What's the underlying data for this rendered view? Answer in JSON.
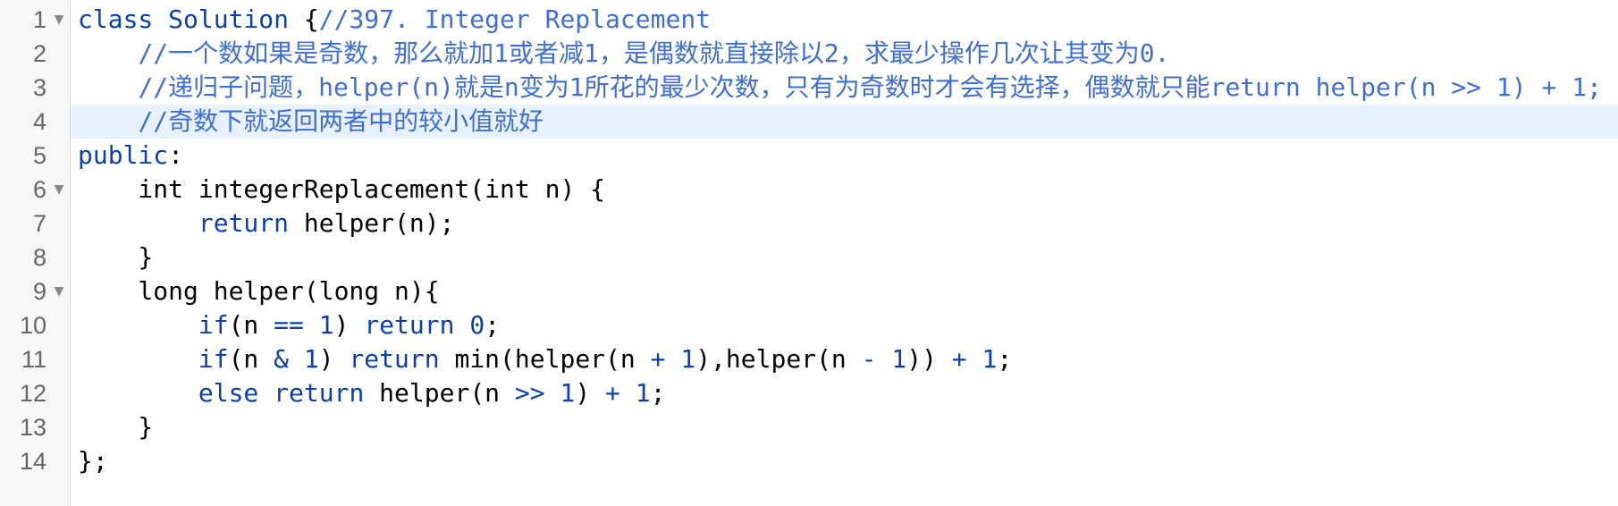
{
  "editor": {
    "active_line": 4,
    "colors": {
      "keyword": "#0b3fb0",
      "comment": "#3f6fd6",
      "plain": "#000000",
      "gutter_bg": "#f7f7f7",
      "active_line_bg": "#e8f2ff"
    },
    "lines": [
      {
        "number": "1",
        "fold": true,
        "tokens": [
          {
            "type": "keyword",
            "text": "class Solution"
          },
          {
            "type": "plain",
            "text": " {"
          },
          {
            "type": "comment",
            "text": "//397. Integer Replacement"
          }
        ]
      },
      {
        "number": "2",
        "fold": false,
        "tokens": [
          {
            "type": "plain",
            "text": "    "
          },
          {
            "type": "comment",
            "text": "//一个数如果是奇数，那么就加1或者减1，是偶数就直接除以2，求最少操作几次让其变为0."
          }
        ]
      },
      {
        "number": "3",
        "fold": false,
        "tokens": [
          {
            "type": "plain",
            "text": "    "
          },
          {
            "type": "comment",
            "text": "//递归子问题，helper(n)就是n变为1所花的最少次数，只有为奇数时才会有选择，偶数就只能return helper(n >> 1) + 1;"
          }
        ]
      },
      {
        "number": "4",
        "fold": false,
        "tokens": [
          {
            "type": "plain",
            "text": "    "
          },
          {
            "type": "comment",
            "text": "//奇数下就返回两者中的较小值就好"
          }
        ]
      },
      {
        "number": "5",
        "fold": false,
        "tokens": [
          {
            "type": "keyword",
            "text": "public"
          },
          {
            "type": "plain",
            "text": ":"
          }
        ]
      },
      {
        "number": "6",
        "fold": true,
        "tokens": [
          {
            "type": "plain",
            "text": "    int integerReplacement(int n) {"
          }
        ]
      },
      {
        "number": "7",
        "fold": false,
        "tokens": [
          {
            "type": "plain",
            "text": "        "
          },
          {
            "type": "keyword",
            "text": "return"
          },
          {
            "type": "plain",
            "text": " helper(n);"
          }
        ]
      },
      {
        "number": "8",
        "fold": false,
        "tokens": [
          {
            "type": "plain",
            "text": "    }"
          }
        ]
      },
      {
        "number": "9",
        "fold": true,
        "tokens": [
          {
            "type": "plain",
            "text": "    long helper(long n){"
          }
        ]
      },
      {
        "number": "10",
        "fold": false,
        "tokens": [
          {
            "type": "plain",
            "text": "        "
          },
          {
            "type": "keyword",
            "text": "if"
          },
          {
            "type": "plain",
            "text": "(n "
          },
          {
            "type": "operator",
            "text": "=="
          },
          {
            "type": "plain",
            "text": " "
          },
          {
            "type": "number",
            "text": "1"
          },
          {
            "type": "plain",
            "text": ") "
          },
          {
            "type": "keyword",
            "text": "return"
          },
          {
            "type": "plain",
            "text": " "
          },
          {
            "type": "number",
            "text": "0"
          },
          {
            "type": "plain",
            "text": ";"
          }
        ]
      },
      {
        "number": "11",
        "fold": false,
        "tokens": [
          {
            "type": "plain",
            "text": "        "
          },
          {
            "type": "keyword",
            "text": "if"
          },
          {
            "type": "plain",
            "text": "(n "
          },
          {
            "type": "operator",
            "text": "&"
          },
          {
            "type": "plain",
            "text": " "
          },
          {
            "type": "number",
            "text": "1"
          },
          {
            "type": "plain",
            "text": ") "
          },
          {
            "type": "keyword",
            "text": "return"
          },
          {
            "type": "plain",
            "text": " min(helper(n "
          },
          {
            "type": "operator",
            "text": "+"
          },
          {
            "type": "plain",
            "text": " "
          },
          {
            "type": "number",
            "text": "1"
          },
          {
            "type": "plain",
            "text": "),helper(n "
          },
          {
            "type": "operator",
            "text": "-"
          },
          {
            "type": "plain",
            "text": " "
          },
          {
            "type": "number",
            "text": "1"
          },
          {
            "type": "plain",
            "text": ")) "
          },
          {
            "type": "operator",
            "text": "+"
          },
          {
            "type": "plain",
            "text": " "
          },
          {
            "type": "number",
            "text": "1"
          },
          {
            "type": "plain",
            "text": ";"
          }
        ]
      },
      {
        "number": "12",
        "fold": false,
        "tokens": [
          {
            "type": "plain",
            "text": "        "
          },
          {
            "type": "keyword",
            "text": "else"
          },
          {
            "type": "plain",
            "text": " "
          },
          {
            "type": "keyword",
            "text": "return"
          },
          {
            "type": "plain",
            "text": " helper(n "
          },
          {
            "type": "operator",
            "text": ">>"
          },
          {
            "type": "plain",
            "text": " "
          },
          {
            "type": "number",
            "text": "1"
          },
          {
            "type": "plain",
            "text": ") "
          },
          {
            "type": "operator",
            "text": "+"
          },
          {
            "type": "plain",
            "text": " "
          },
          {
            "type": "number",
            "text": "1"
          },
          {
            "type": "plain",
            "text": ";"
          }
        ]
      },
      {
        "number": "13",
        "fold": false,
        "tokens": [
          {
            "type": "plain",
            "text": "    }"
          }
        ]
      },
      {
        "number": "14",
        "fold": false,
        "tokens": [
          {
            "type": "plain",
            "text": "};"
          }
        ]
      }
    ]
  }
}
